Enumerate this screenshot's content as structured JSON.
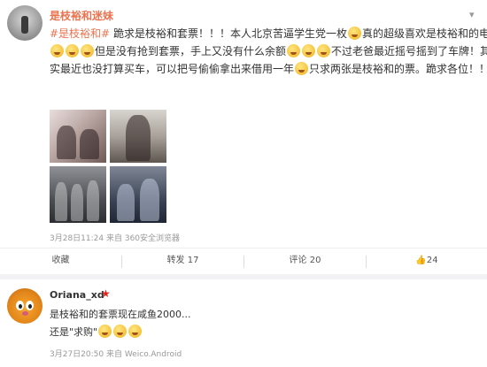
{
  "post": {
    "username": "是枝裕和迷妹",
    "line1_tag": "#是枝裕和#",
    "line1_text": " 跪求是枝裕和套票！！！本人北京苦逼学生党一枚",
    "line1_text_b": "真的超级喜欢是枝裕和的电影",
    "line2_text": "但是没有抢到套票，手上又没有什么余额",
    "line2_text_b": "不过老爸最近摇号摇到了车牌！其",
    "line3_text": "实最近也没打算买车，可以把号偷偷拿出来借用一年",
    "line3_text_b": "只求两张是枝裕和的票。跪求各位！！！",
    "meta": "3月28日11:24 来自 360安全浏览器",
    "actions": {
      "collect": "收藏",
      "repost": "转发 17",
      "comment": "评论 20",
      "like": "24"
    }
  },
  "comment": {
    "username": "Oriana_xd",
    "badge": "★",
    "line1": "是枝裕和的套票现在咸鱼2000...",
    "line2": "还是\"求购\"",
    "meta": "3月27日20:50 来自 Weico.Android"
  },
  "icons": [
    "chevron-down-icon",
    "emoji-icon",
    "thumbs-up-icon",
    "star-badge-icon"
  ]
}
